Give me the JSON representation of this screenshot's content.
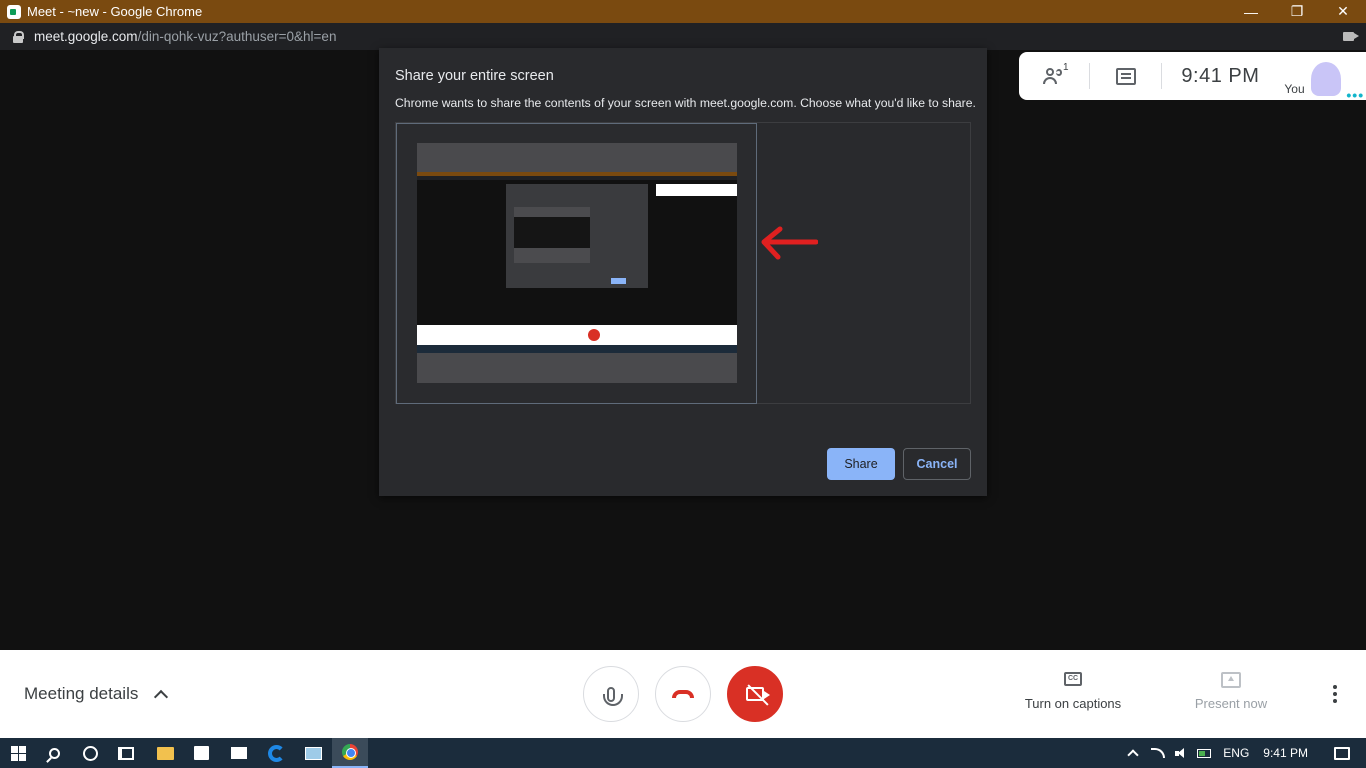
{
  "window": {
    "title": "Meet - ~new - Google Chrome",
    "controls": {
      "minimize": "—",
      "restore": "❐",
      "close": "✕"
    }
  },
  "address_bar": {
    "host": "meet.google.com",
    "path": "/din-qohk-vuz?authuser=0&hl=en"
  },
  "info_panel": {
    "participant_count": "1",
    "time": "9:41 PM",
    "you_label": "You"
  },
  "dialog": {
    "title": "Share your entire screen",
    "description": "Chrome wants to share the contents of your screen with meet.google.com. Choose what you'd like to share.",
    "share_label": "Share",
    "cancel_label": "Cancel"
  },
  "callbar": {
    "meeting_details": "Meeting details",
    "captions_label": "Turn on captions",
    "present_label": "Present now"
  },
  "taskbar": {
    "language": "ENG",
    "time": "9:41 PM"
  },
  "colors": {
    "titlebar": "#7a4a10",
    "dialog_bg": "#292a2d",
    "accent_blue": "#8ab4f8",
    "end_call_red": "#d93025",
    "annotation_red": "#e02020"
  }
}
